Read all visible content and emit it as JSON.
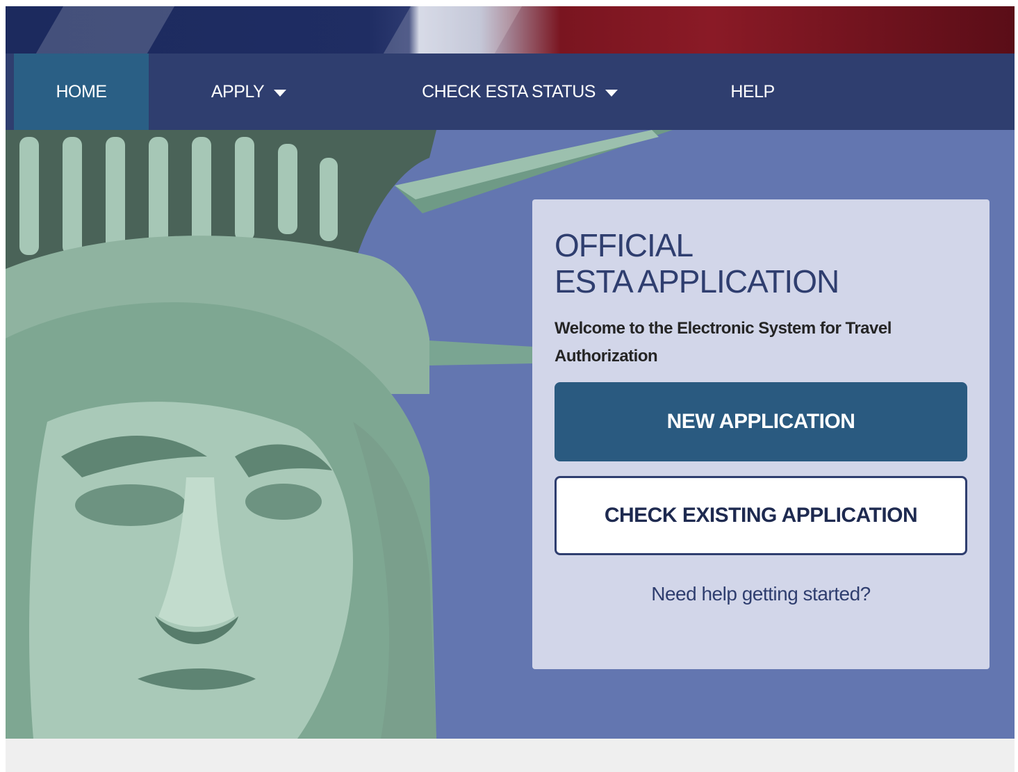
{
  "nav": {
    "items": [
      {
        "label": "HOME",
        "active": true,
        "dropdown": false
      },
      {
        "label": "APPLY",
        "active": false,
        "dropdown": true
      },
      {
        "label": "CHECK ESTA STATUS",
        "active": false,
        "dropdown": true
      },
      {
        "label": "HELP",
        "active": false,
        "dropdown": false
      }
    ]
  },
  "card": {
    "title_line1": "OFFICIAL",
    "title_line2": "ESTA APPLICATION",
    "subtitle": "Welcome to the Electronic System for Travel Authorization",
    "new_application_label": "NEW APPLICATION",
    "check_existing_label": "CHECK EXISTING APPLICATION",
    "help_link": "Need help getting started?"
  },
  "colors": {
    "nav_bg": "#2f3e6f",
    "nav_active": "#2a5f85",
    "hero_bg": "#6376b0",
    "card_bg": "#d2d6e9",
    "primary_button": "#2a5a80"
  },
  "icons": {
    "dropdown": "caret-down-icon"
  }
}
